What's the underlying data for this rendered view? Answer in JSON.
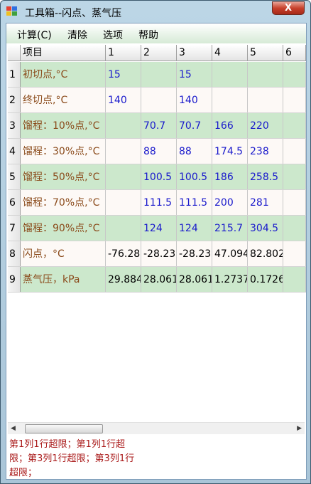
{
  "window": {
    "title": "工具箱--闪点、蒸气压",
    "close_label": "X"
  },
  "menu": [
    "计算(C)",
    "清除",
    "选项",
    "帮助"
  ],
  "grid": {
    "columns": [
      "项目",
      "1",
      "2",
      "3",
      "4",
      "5",
      "6"
    ],
    "rows": [
      {
        "num": "1",
        "name": "初切点,°C",
        "cells": [
          "15",
          "",
          "15",
          "",
          "",
          ""
        ]
      },
      {
        "num": "2",
        "name": "终切点,°C",
        "cells": [
          "140",
          "",
          "140",
          "",
          "",
          ""
        ]
      },
      {
        "num": "3",
        "name": "馏程：10%点,°C",
        "cells": [
          "",
          "70.7",
          "70.7",
          "166",
          "220",
          ""
        ]
      },
      {
        "num": "4",
        "name": "馏程：30%点,°C",
        "cells": [
          "",
          "88",
          "88",
          "174.5",
          "238",
          ""
        ]
      },
      {
        "num": "5",
        "name": "馏程：50%点,°C",
        "cells": [
          "",
          "100.5",
          "100.5",
          "186",
          "258.5",
          ""
        ]
      },
      {
        "num": "6",
        "name": "馏程：70%点,°C",
        "cells": [
          "",
          "111.5",
          "111.5",
          "200",
          "281",
          ""
        ]
      },
      {
        "num": "7",
        "name": "馏程：90%点,°C",
        "cells": [
          "",
          "124",
          "124",
          "215.7",
          "304.5",
          ""
        ]
      },
      {
        "num": "8",
        "name": "闪点，°C",
        "cells": [
          "-76.28",
          "-28.23",
          "-28.23",
          "47.094",
          "82.802",
          ""
        ]
      },
      {
        "num": "9",
        "name": "蒸气压，kPa",
        "cells": [
          "29.884",
          "28.061",
          "28.061",
          "1.2737",
          "0.1726",
          ""
        ]
      }
    ]
  },
  "messages": [
    "第1列1行超限；第1列1行超",
    "限；第3列1行超限；第3列1行",
    "超限；"
  ],
  "colors": {
    "row_green": "#cce8cc",
    "name_text": "#8a4a1a",
    "input_text": "#1a1acc",
    "message_text": "#aa1a1a"
  }
}
